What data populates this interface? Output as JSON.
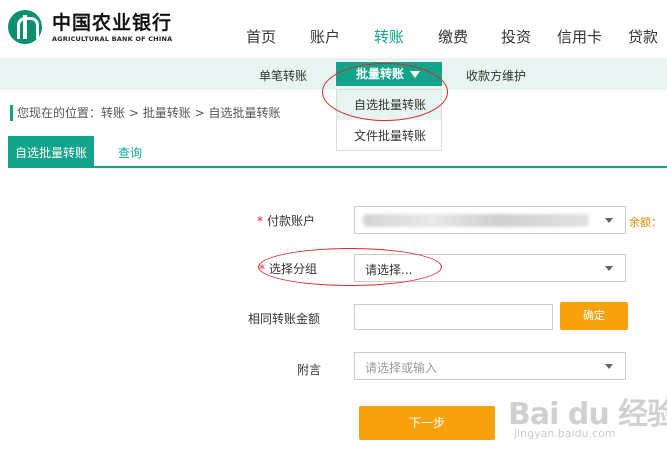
{
  "brand": {
    "name_cn": "中国农业银行",
    "name_en": "AGRICULTURAL BANK OF CHINA",
    "color": "#12a48a"
  },
  "main_nav": [
    "首页",
    "账户",
    "转账",
    "缴费",
    "投资",
    "信用卡",
    "贷款"
  ],
  "main_nav_active": "转账",
  "sub_nav": {
    "single": "单笔转账",
    "batch": "批量转账",
    "payee": "收款方维护"
  },
  "dropdown": {
    "items": [
      "自选批量转账",
      "文件批量转账"
    ],
    "highlighted": "自选批量转账"
  },
  "breadcrumb": {
    "prefix": "您现在的位置：",
    "path": [
      "转账",
      "批量转账",
      "自选批量转账"
    ],
    "separator": ">"
  },
  "tabs": {
    "active": "自选批量转账",
    "other": "查询"
  },
  "form": {
    "payer_label": "付款账户",
    "balance_label": "余额：",
    "group_label": "选择分组",
    "group_value": "请选择...",
    "amount_label": "相同转账金额",
    "amount_value": "",
    "confirm": "确定",
    "note_label": "附言",
    "note_placeholder": "请选择或输入",
    "required_mark": "*",
    "next": "下一步"
  },
  "watermark": {
    "main": "Bai du 经验",
    "sub": "jingyan.baidu.com"
  },
  "colors": {
    "accent": "#12a48a",
    "subnav_bg": "#e7f4f1",
    "button": "#f7a20c",
    "annotation": "#d62a2a",
    "required": "#e22233"
  }
}
